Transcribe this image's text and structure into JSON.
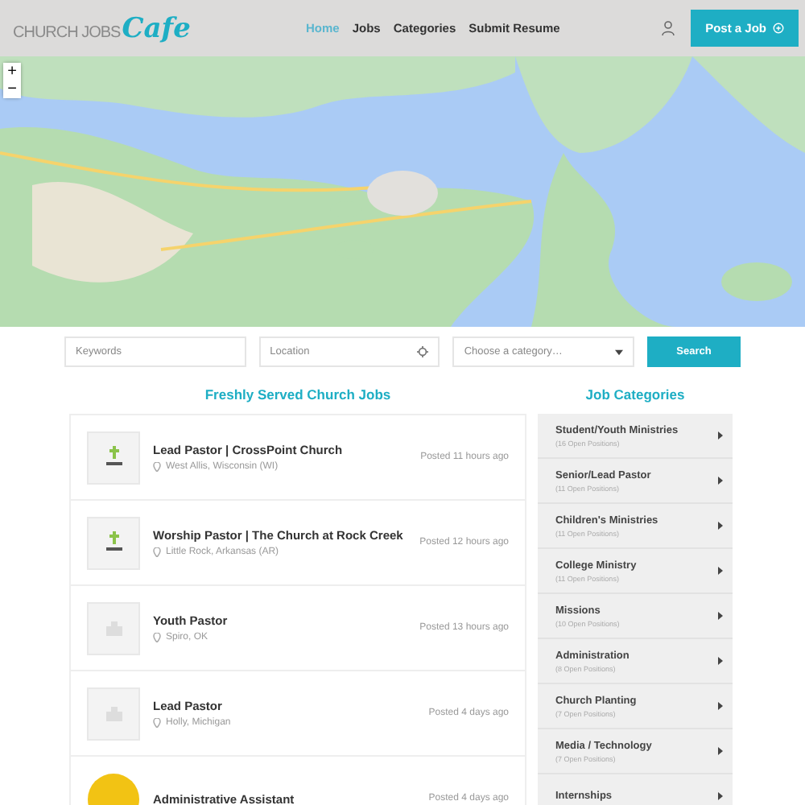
{
  "header": {
    "logo": {
      "text": "CHURCH JOBS",
      "script": "Cafe"
    },
    "nav": [
      {
        "label": "Home",
        "selected": true
      },
      {
        "label": "Jobs",
        "selected": false
      },
      {
        "label": "Categories",
        "selected": false
      },
      {
        "label": "Submit Resume",
        "selected": false
      }
    ],
    "post_button": "Post a Job"
  },
  "map": {
    "zoom_in": "+",
    "zoom_out": "−"
  },
  "search": {
    "keywords": {
      "placeholder": "Keywords"
    },
    "location": {
      "placeholder": "Location"
    },
    "category": {
      "placeholder": "Choose a category…"
    },
    "button": "Search"
  },
  "jobs": {
    "title": "Freshly Served Church Jobs",
    "items": [
      {
        "title": "Lead Pastor | CrossPoint Church",
        "location": "West Allis, Wisconsin (WI)",
        "posted": "Posted 11 hours ago",
        "kind": "church"
      },
      {
        "title": "Worship Pastor | The Church at Rock Creek",
        "location": "Little Rock, Arkansas (AR)",
        "posted": "Posted 12 hours ago",
        "kind": "church"
      },
      {
        "title": "Youth Pastor",
        "location": "Spiro, OK",
        "posted": "Posted 13 hours ago",
        "kind": "placeholder"
      },
      {
        "title": "Lead Pastor",
        "location": "Holly, Michigan",
        "posted": "Posted 4 days ago",
        "kind": "placeholder"
      },
      {
        "title": "Administrative Assistant",
        "posted": "Posted 4 days ago",
        "kind": "badge"
      }
    ]
  },
  "categories": {
    "title": "Job Categories",
    "items": [
      {
        "name": "Student/Youth Ministries",
        "count": "(16 Open Positions)"
      },
      {
        "name": "Senior/Lead Pastor",
        "count": "(11 Open Positions)"
      },
      {
        "name": "Children's Ministries",
        "count": "(11 Open Positions)"
      },
      {
        "name": "College Ministry",
        "count": "(11 Open Positions)"
      },
      {
        "name": "Missions",
        "count": "(10 Open Positions)"
      },
      {
        "name": "Administration",
        "count": "(8 Open Positions)"
      },
      {
        "name": "Church Planting",
        "count": "(7 Open Positions)"
      },
      {
        "name": "Media / Technology",
        "count": "(7 Open Positions)"
      },
      {
        "name": "Internships"
      }
    ]
  }
}
